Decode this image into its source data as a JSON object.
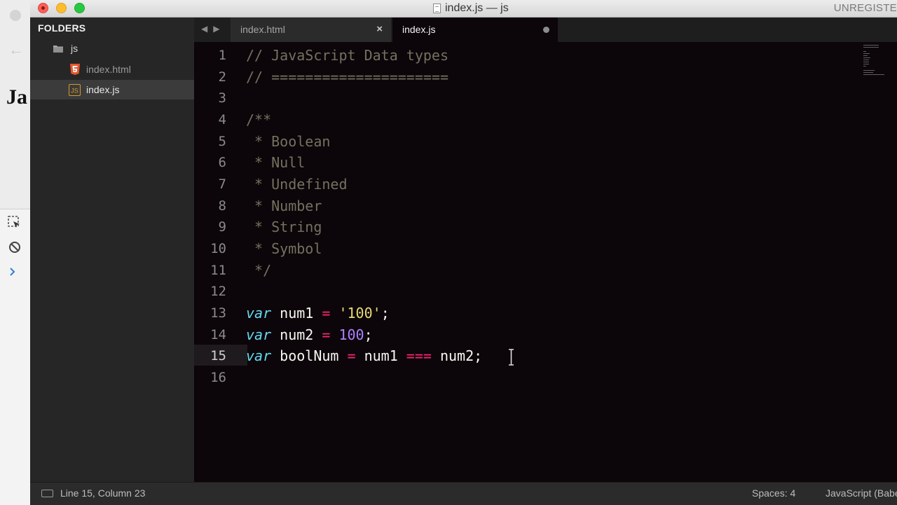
{
  "window": {
    "title": "index.js — js",
    "unregistered": "UNREGISTE"
  },
  "background_window": {
    "heading_fragment": "Ja"
  },
  "sidebar": {
    "header": "FOLDERS",
    "folder": {
      "name": "js",
      "icon": "folder-icon"
    },
    "files": [
      {
        "name": "index.html",
        "icon": "html5-icon",
        "selected": false
      },
      {
        "name": "index.js",
        "icon": "js-file-icon",
        "selected": true
      }
    ]
  },
  "tabs": [
    {
      "label": "index.html",
      "active": false,
      "close_glyph": "×"
    },
    {
      "label": "index.js",
      "active": true,
      "dirty": true
    }
  ],
  "editor": {
    "current_line": 15,
    "line_numbers": [
      "1",
      "2",
      "3",
      "4",
      "5",
      "6",
      "7",
      "8",
      "9",
      "10",
      "11",
      "12",
      "13",
      "14",
      "15",
      "16"
    ],
    "lines": {
      "l1": "// JavaScript Data types",
      "l2": "// =====================",
      "l4": "/**",
      "l5": " * Boolean",
      "l6": " * Null",
      "l7": " * Undefined",
      "l8": " * Number",
      "l9": " * String",
      "l10": " * Symbol",
      "l11": " */",
      "l13": {
        "kw": "var",
        "name": " num1 ",
        "op": "=",
        "str": "'100'",
        "end": ";"
      },
      "l14": {
        "kw": "var",
        "name": " num2 ",
        "op": "=",
        "num": "100",
        "end": ";"
      },
      "l15": {
        "kw": "var",
        "name": " boolNum ",
        "op": "=",
        "mid": " num1 ",
        "op2": "===",
        "end": " num2;"
      }
    },
    "colors": {
      "comment": "#75715e",
      "keyword": "#66d9ef",
      "operator": "#f92672",
      "string": "#e6db74",
      "number": "#ae81ff",
      "background": "#0c050a"
    }
  },
  "statusbar": {
    "position": "Line 15, Column 23",
    "spaces": "Spaces: 4",
    "syntax": "JavaScript (Babel)"
  }
}
